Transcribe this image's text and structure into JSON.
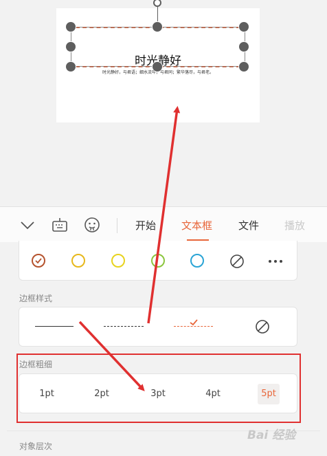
{
  "slide": {
    "title": "时光静好",
    "subtitle": "时光静好，与君语；细水流年，与君同；繁华落尽，与君老。"
  },
  "toolbar": {
    "icons": [
      "chevron-down-icon",
      "keyboard-icon",
      "emoji-icon"
    ],
    "tabs": [
      {
        "label": "开始",
        "active": false
      },
      {
        "label": "文本框",
        "active": true
      },
      {
        "label": "文件",
        "active": false
      },
      {
        "label": "播放",
        "active": false
      }
    ]
  },
  "colors": {
    "options": [
      {
        "name": "brown",
        "hex": "#b5532e",
        "selected": true
      },
      {
        "name": "gold",
        "hex": "#e7b81c",
        "selected": false
      },
      {
        "name": "yellow",
        "hex": "#e8d31f",
        "selected": false
      },
      {
        "name": "green",
        "hex": "#8cc63f",
        "selected": false
      },
      {
        "name": "blue",
        "hex": "#2aa4d5",
        "selected": false
      }
    ],
    "none_icon": "no-color-icon",
    "more_icon": "more-icon"
  },
  "border_style": {
    "label": "边框样式",
    "options": [
      "solid",
      "dashed",
      "dotted-selected",
      "none"
    ],
    "selected": "dotted"
  },
  "border_thickness": {
    "label": "边框粗细",
    "options": [
      "1pt",
      "2pt",
      "3pt",
      "4pt",
      "5pt"
    ],
    "selected": "5pt"
  },
  "layer": {
    "label": "对象层次"
  },
  "watermark": "Bai 经验",
  "accent_color": "#e8663a",
  "highlight_color": "#e03030"
}
